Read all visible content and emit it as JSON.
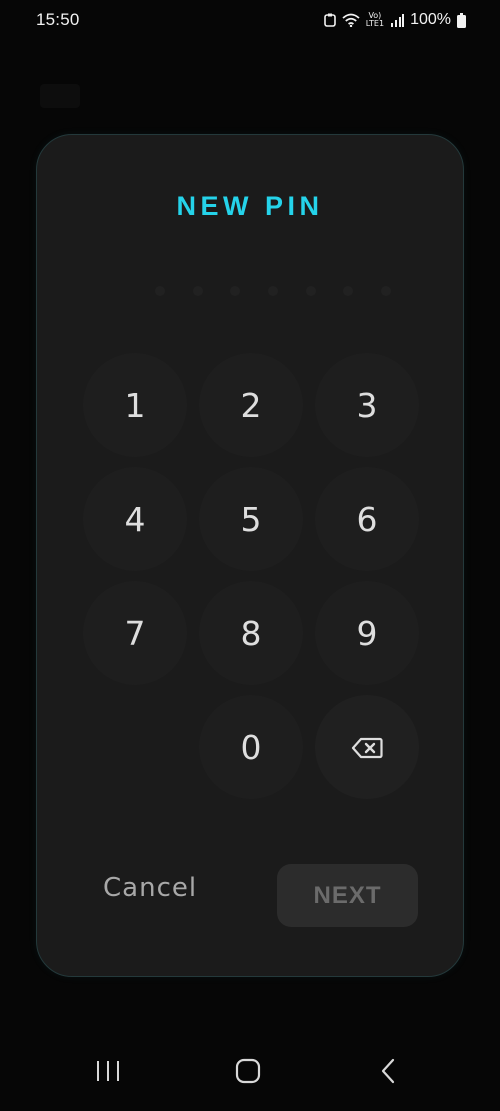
{
  "status_bar": {
    "time": "15:50",
    "volte_top": "Vo)",
    "volte_bottom": "LTE1",
    "battery": "100%",
    "icons": [
      "screenshot-icon",
      "wifi-icon",
      "volte-icon",
      "signal-icon",
      "battery-icon"
    ]
  },
  "dialog": {
    "title": "NEW PIN",
    "title_color": "#25d3ea",
    "pin_length": 7,
    "keys": [
      "1",
      "2",
      "3",
      "4",
      "5",
      "6",
      "7",
      "8",
      "9",
      "",
      "0",
      "backspace-icon"
    ],
    "cancel_label": "Cancel",
    "next_label": "NEXT"
  },
  "nav_bar": {
    "icons": [
      "recents-icon",
      "home-icon",
      "back-icon"
    ]
  }
}
